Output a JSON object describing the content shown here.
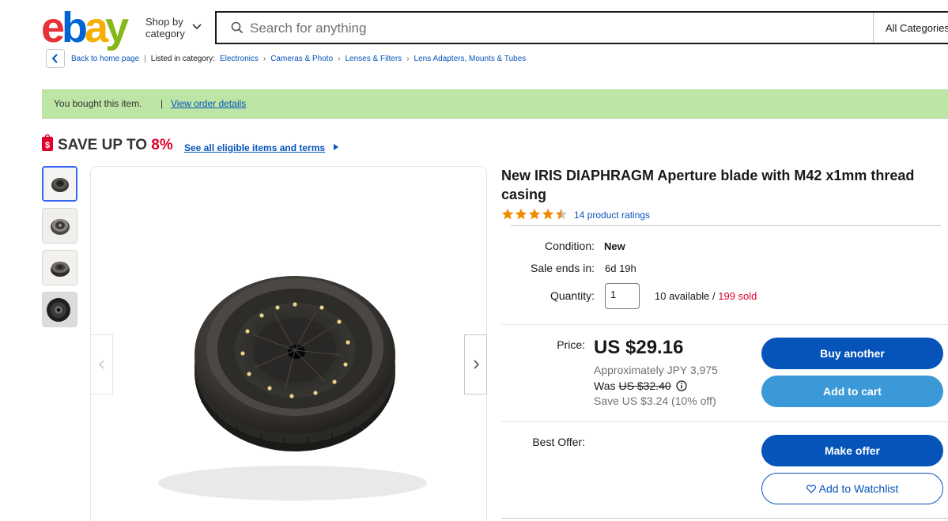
{
  "header": {
    "logo_letters": [
      "e",
      "b",
      "a",
      "y"
    ],
    "logo_colors": [
      "#e53238",
      "#0064d2",
      "#f5af02",
      "#86b817"
    ],
    "shop_by_line1": "Shop by",
    "shop_by_line2": "category",
    "search_placeholder": "Search for anything",
    "search_category": "All Categories"
  },
  "breadcrumb": {
    "back_label": "Back to home page",
    "listed_in": "Listed in category:",
    "items": [
      "Electronics",
      "Cameras & Photo",
      "Lenses & Filters",
      "Lens Adapters, Mounts & Tubes"
    ]
  },
  "notice": {
    "text": "You bought this item.",
    "separator": "|",
    "link": "View order details",
    "color": "#bde5a5"
  },
  "promo": {
    "save_prefix": "SAVE UP TO",
    "save_percent": "8%",
    "link": "See all eligible items and terms"
  },
  "gallery": {
    "thumbnail_count": 4,
    "active_thumbnail": 1
  },
  "product": {
    "title": "New IRIS DIAPHRAGM Aperture blade with M42 x1mm thread casing",
    "rating": 4.5,
    "rating_link": "14 product ratings",
    "condition_label": "Condition:",
    "condition_value": "New",
    "sale_label": "Sale ends in:",
    "sale_value": "6d 19h",
    "quantity_label": "Quantity:",
    "quantity_value": "1",
    "available": "10 available /",
    "sold": "199 sold"
  },
  "pricing": {
    "price_label": "Price:",
    "price": "US $29.16",
    "approx_prefix": "Approximately",
    "approx_value": "JPY 3,975",
    "was_label": "Was",
    "was_value": "US $32.40",
    "save_text": "Save US $3.24 (10% off)",
    "best_offer_label": "Best Offer:"
  },
  "actions": {
    "buy_another": "Buy another",
    "add_to_cart": "Add to cart",
    "make_offer": "Make offer",
    "add_to_watchlist": "Add to Watchlist"
  },
  "colors": {
    "link_blue": "#0654ba",
    "primary_button": "#0654ba",
    "cart_button": "#3a99d6",
    "sale_red": "#e0002a",
    "star_orange": "#f18c00"
  }
}
